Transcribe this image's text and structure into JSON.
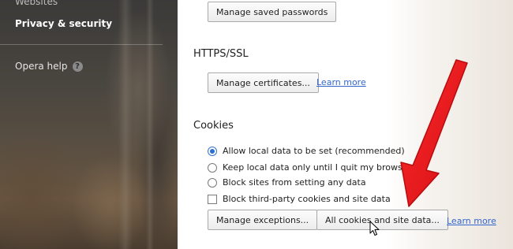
{
  "sidebar": {
    "partial_item": "Websites",
    "active_item": "Privacy & security",
    "help_label": "Opera help",
    "help_icon": "help-circle-icon"
  },
  "main": {
    "passwords_button": "Manage saved passwords",
    "https": {
      "heading": "HTTPS/SSL",
      "button": "Manage certificates...",
      "learn_more": "Learn more"
    },
    "cookies": {
      "heading": "Cookies",
      "options": [
        {
          "label": "Allow local data to be set (recommended)",
          "selected": true
        },
        {
          "label": "Keep local data only until I quit my browser",
          "selected": false
        },
        {
          "label": "Block sites from setting any data",
          "selected": false
        }
      ],
      "checkbox": {
        "label": "Block third-party cookies and site data",
        "checked": false
      },
      "exceptions_button": "Manage exceptions...",
      "all_cookies_button": "All cookies and site data...",
      "learn_more": "Learn more"
    }
  },
  "colors": {
    "annotation_arrow": "#e8161b",
    "link": "#3366cc",
    "radio_selected": "#2c6fd1"
  }
}
